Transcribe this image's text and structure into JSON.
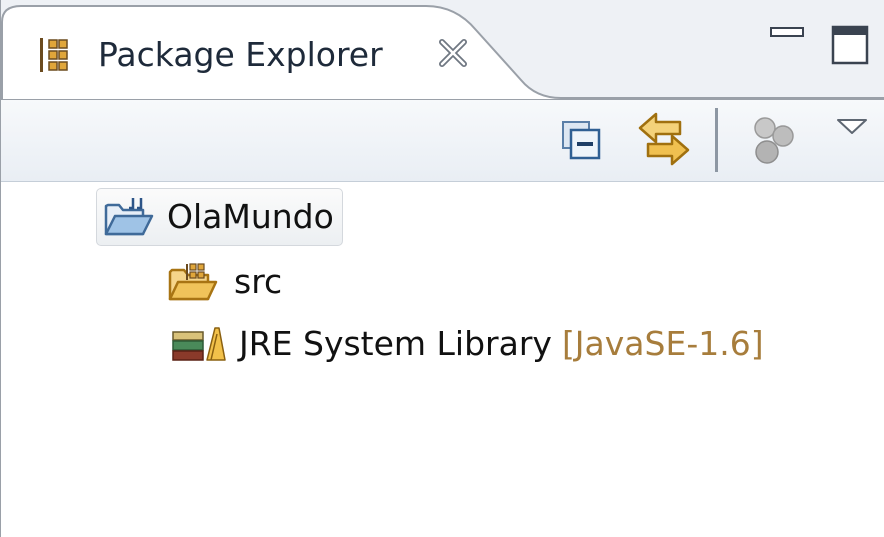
{
  "view": {
    "title": "Package Explorer",
    "icons": {
      "tab": "package-explorer-icon",
      "close": "close-icon",
      "minimize": "minimize-icon",
      "maximize": "maximize-icon"
    }
  },
  "toolbar": {
    "items": [
      {
        "name": "collapse-all",
        "icon": "collapse-all-icon",
        "enabled": true
      },
      {
        "name": "link-with-editor",
        "icon": "link-with-editor-icon",
        "enabled": true
      },
      {
        "name": "focus-on-active-task",
        "icon": "focus-task-icon",
        "enabled": false
      },
      {
        "name": "view-menu",
        "icon": "chevron-down-icon",
        "enabled": true
      }
    ]
  },
  "tree": {
    "project": {
      "label": "OlaMundo",
      "icon": "project-folder-icon",
      "selected": true
    },
    "children": [
      {
        "label": "src",
        "decoration": "",
        "icon": "source-folder-icon"
      },
      {
        "label": "JRE System Library",
        "decoration": "[JavaSE-1.6]",
        "icon": "library-icon"
      }
    ]
  },
  "colors": {
    "tab_background": "#eef1f5",
    "decoration_text": "#a77d3c",
    "icon_orange": "#e8a534"
  }
}
